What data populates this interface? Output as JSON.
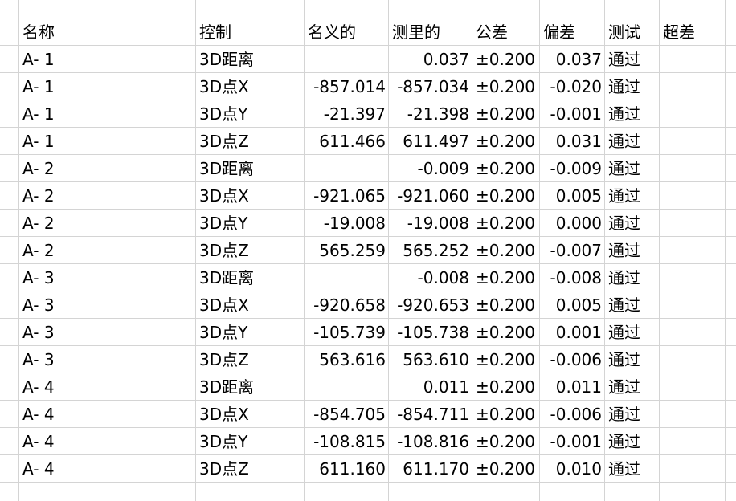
{
  "sheet": {
    "headers": {
      "name": "名称",
      "control": "控制",
      "nominal": "名义的",
      "measured": "测里的",
      "tolerance": "公差",
      "deviation": "偏差",
      "test": "测试",
      "out_of_tol": "超差"
    },
    "rows": [
      {
        "name": "A- 1",
        "control": "3D距离",
        "nominal": "",
        "measured": "0.037",
        "tolerance": "±0.200",
        "deviation": "0.037",
        "test": "通过",
        "out_of_tol": ""
      },
      {
        "name": "A- 1",
        "control": "3D点X",
        "nominal": "-857.014",
        "measured": "-857.034",
        "tolerance": "±0.200",
        "deviation": "-0.020",
        "test": "通过",
        "out_of_tol": ""
      },
      {
        "name": "A- 1",
        "control": "3D点Y",
        "nominal": "-21.397",
        "measured": "-21.398",
        "tolerance": "±0.200",
        "deviation": "-0.001",
        "test": "通过",
        "out_of_tol": ""
      },
      {
        "name": "A- 1",
        "control": "3D点Z",
        "nominal": "611.466",
        "measured": "611.497",
        "tolerance": "±0.200",
        "deviation": "0.031",
        "test": "通过",
        "out_of_tol": ""
      },
      {
        "name": "A- 2",
        "control": "3D距离",
        "nominal": "",
        "measured": "-0.009",
        "tolerance": "±0.200",
        "deviation": "-0.009",
        "test": "通过",
        "out_of_tol": ""
      },
      {
        "name": "A- 2",
        "control": "3D点X",
        "nominal": "-921.065",
        "measured": "-921.060",
        "tolerance": "±0.200",
        "deviation": "0.005",
        "test": "通过",
        "out_of_tol": ""
      },
      {
        "name": "A- 2",
        "control": "3D点Y",
        "nominal": "-19.008",
        "measured": "-19.008",
        "tolerance": "±0.200",
        "deviation": "0.000",
        "test": "通过",
        "out_of_tol": ""
      },
      {
        "name": "A- 2",
        "control": "3D点Z",
        "nominal": "565.259",
        "measured": "565.252",
        "tolerance": "±0.200",
        "deviation": "-0.007",
        "test": "通过",
        "out_of_tol": ""
      },
      {
        "name": "A- 3",
        "control": "3D距离",
        "nominal": "",
        "measured": "-0.008",
        "tolerance": "±0.200",
        "deviation": "-0.008",
        "test": "通过",
        "out_of_tol": ""
      },
      {
        "name": "A- 3",
        "control": "3D点X",
        "nominal": "-920.658",
        "measured": "-920.653",
        "tolerance": "±0.200",
        "deviation": "0.005",
        "test": "通过",
        "out_of_tol": ""
      },
      {
        "name": "A- 3",
        "control": "3D点Y",
        "nominal": "-105.739",
        "measured": "-105.738",
        "tolerance": "±0.200",
        "deviation": "0.001",
        "test": "通过",
        "out_of_tol": ""
      },
      {
        "name": "A- 3",
        "control": "3D点Z",
        "nominal": "563.616",
        "measured": "563.610",
        "tolerance": "±0.200",
        "deviation": "-0.006",
        "test": "通过",
        "out_of_tol": ""
      },
      {
        "name": "A- 4",
        "control": "3D距离",
        "nominal": "",
        "measured": "0.011",
        "tolerance": "±0.200",
        "deviation": "0.011",
        "test": "通过",
        "out_of_tol": ""
      },
      {
        "name": "A- 4",
        "control": "3D点X",
        "nominal": "-854.705",
        "measured": "-854.711",
        "tolerance": "±0.200",
        "deviation": "-0.006",
        "test": "通过",
        "out_of_tol": ""
      },
      {
        "name": "A- 4",
        "control": "3D点Y",
        "nominal": "-108.815",
        "measured": "-108.816",
        "tolerance": "±0.200",
        "deviation": "-0.001",
        "test": "通过",
        "out_of_tol": ""
      },
      {
        "name": "A- 4",
        "control": "3D点Z",
        "nominal": "611.160",
        "measured": "611.170",
        "tolerance": "±0.200",
        "deviation": "0.010",
        "test": "通过",
        "out_of_tol": ""
      }
    ]
  }
}
